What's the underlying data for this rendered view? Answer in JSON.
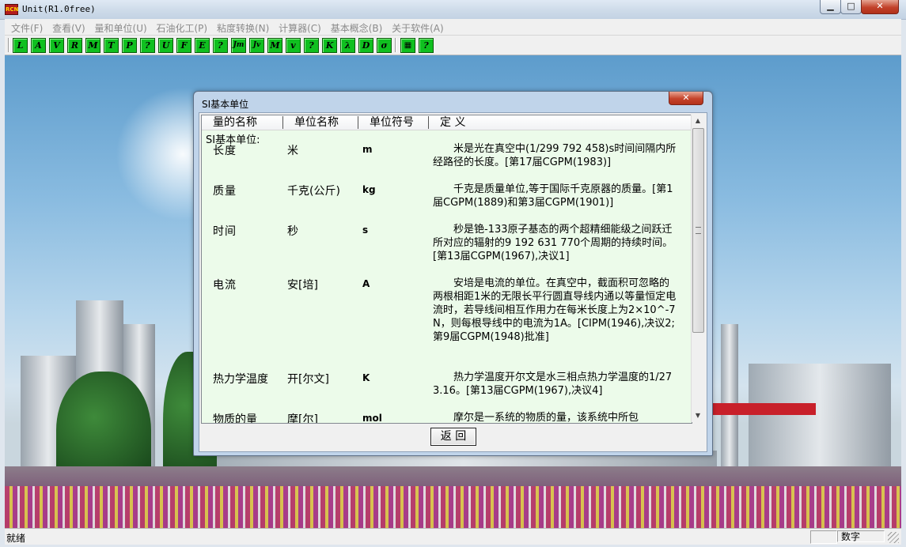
{
  "window": {
    "title": "Unit(R1.0free)",
    "icon": "RCN"
  },
  "menu": [
    {
      "label": "文件(F)"
    },
    {
      "label": "查看(V)"
    },
    {
      "label": "量和单位(U)"
    },
    {
      "label": "石油化工(P)"
    },
    {
      "label": "粘度转换(N)"
    },
    {
      "label": "计算器(C)"
    },
    {
      "label": "基本概念(B)"
    },
    {
      "label": "关于软件(A)"
    }
  ],
  "toolbar": [
    "L",
    "A",
    "V",
    "R",
    "M",
    "T",
    "P",
    "?",
    "U",
    "F",
    "E",
    "?",
    "Jm",
    "Jv",
    "M",
    "v",
    "?",
    "K",
    "λ",
    "D",
    "σ",
    "▦",
    "?"
  ],
  "dialog": {
    "title": "SI基本单位",
    "columns": [
      "量的名称",
      "单位名称",
      "单位符号",
      "定 义"
    ],
    "section": "SI基本单位:",
    "rows": [
      {
        "quantity": "长度",
        "unit": "米",
        "symbol": "m",
        "definition": "米是光在真空中(1/299 792 458)s时间间隔内所经路径的长度。[第17届CGPM(1983)]"
      },
      {
        "quantity": "质量",
        "unit": "千克(公斤)",
        "symbol": "kg",
        "definition": "千克是质量单位,等于国际千克原器的质量。[第1届CGPM(1889)和第3届CGPM(1901)]"
      },
      {
        "quantity": "时间",
        "unit": "秒",
        "symbol": "s",
        "definition": "秒是铯-133原子基态的两个超精细能级之间跃迁所对应的辐射的9 192 631 770个周期的持续时间。[第13届CGPM(1967),决议1]"
      },
      {
        "quantity": "电流",
        "unit": "安[培]",
        "symbol": "A",
        "definition": "安培是电流的单位。在真空中，截面积可忽略的两根相距1米的无限长平行圆直导线内通以等量恒定电流时，若导线间相互作用力在每米长度上为2×10^-7N，则每根导线中的电流为1A。[CIPM(1946),决议2;第9届CGPM(1948)批准]"
      },
      {
        "quantity": "热力学温度",
        "unit": "开[尔文]",
        "symbol": "K",
        "definition": "热力学温度开尔文是水三相点热力学温度的1/273.16。[第13届CGPM(1967),决议4]"
      },
      {
        "quantity": "物质的量",
        "unit": "摩[尔]",
        "symbol": "mol",
        "definition": "摩尔是一系统的物质的量，该系统中所包"
      }
    ],
    "back_button": "返 回"
  },
  "status": {
    "text": "就绪",
    "num_indicator": "数字"
  }
}
